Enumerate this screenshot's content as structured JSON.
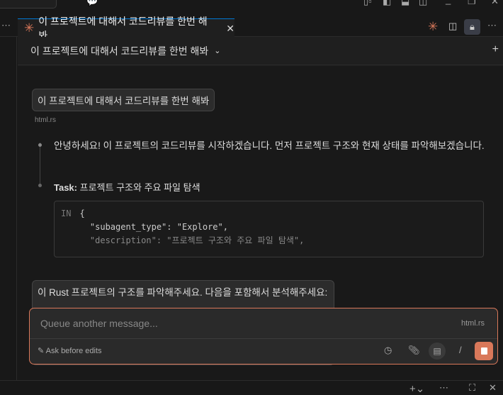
{
  "tab": {
    "title": "이 프로젝트에 대해서 코드리뷰를 한번 해봐"
  },
  "header": {
    "title": "이 프로젝트에 대해서 코드리뷰를 한번 해봐"
  },
  "messages": {
    "user1": "이 프로젝트에 대해서 코드리뷰를 한번 해봐",
    "user1_file": "html.rs",
    "assistant1": "안녕하세요! 이 프로젝트의 코드리뷰를 시작하겠습니다. 먼저 프로젝트 구조와 현재 상태를 파악해보겠습니다.",
    "task_label": "Task:",
    "task_title": "프로젝트 구조와 주요 파일 탐색",
    "code_in": "IN",
    "code_lines": [
      "{",
      "  \"subagent_type\": \"Explore\",",
      "  \"description\": \"프로젝트 구조와 주요 파일 탐색\","
    ],
    "user2": "이 Rust 프로젝트의 구조를 파악해주세요. 다음을 포함해서 분석해주세요:"
  },
  "input": {
    "placeholder": "Queue another message...",
    "file": "html.rs",
    "mode": "Ask before edits",
    "slash": "/"
  },
  "colors": {
    "accent": "#d9785a",
    "tab_border": "#0078d4"
  }
}
